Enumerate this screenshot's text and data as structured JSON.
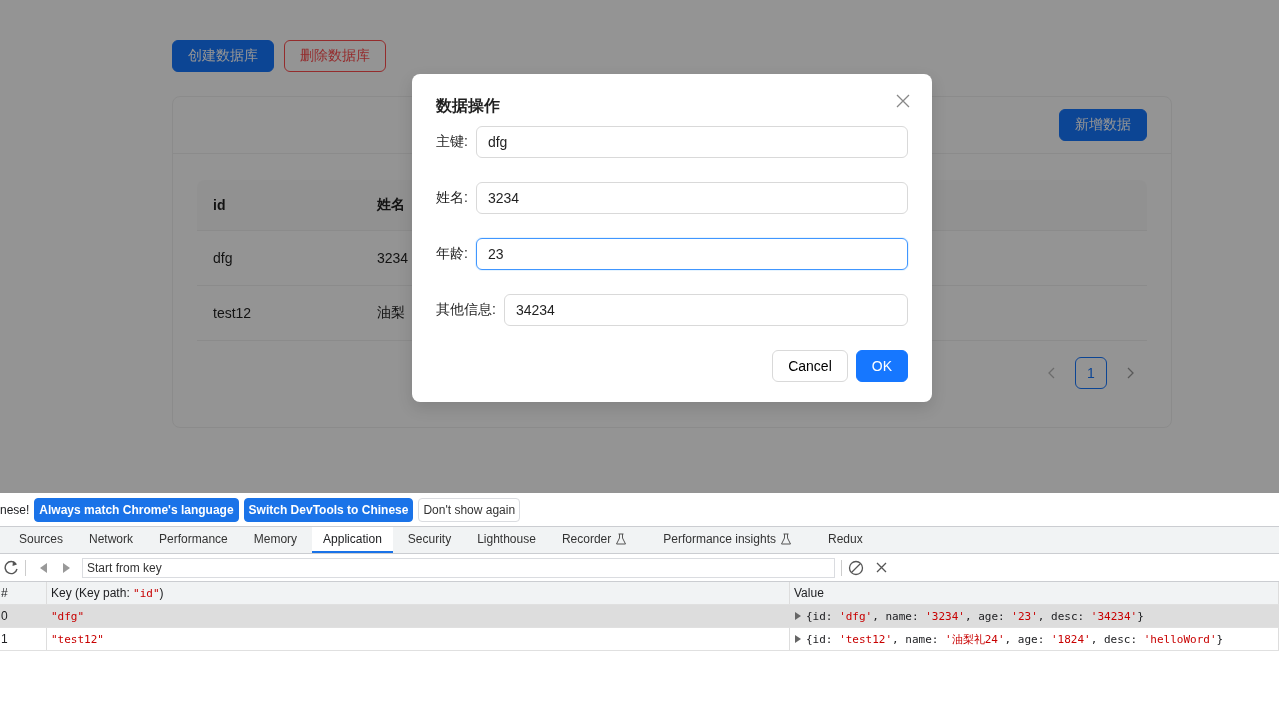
{
  "page": {
    "actions": [
      {
        "label": "创建数据库",
        "kind": "primary"
      },
      {
        "label": "删除数据库",
        "kind": "danger"
      }
    ],
    "card": {
      "add_button": "新增数据",
      "table": {
        "columns": [
          "id",
          "姓名"
        ],
        "rows": [
          [
            "dfg",
            "3234"
          ],
          [
            "test12",
            "油梨"
          ]
        ]
      },
      "pagination": [
        {
          "label": "1",
          "selected": true
        }
      ]
    }
  },
  "modal": {
    "title": "数据操作",
    "fields": [
      {
        "label": "主键:",
        "value": "dfg",
        "focused": false
      },
      {
        "label": "姓名:",
        "value": "3234",
        "focused": false
      },
      {
        "label": "年龄:",
        "value": "23",
        "focused": true
      },
      {
        "label": "其他信息:",
        "value": "34234",
        "focused": false
      }
    ],
    "buttons": [
      {
        "label": "Cancel",
        "kind": "default"
      },
      {
        "label": "OK",
        "kind": "primary"
      }
    ]
  },
  "devtools": {
    "infobar": {
      "message": "nese!",
      "buttons": [
        {
          "label": "Always match Chrome's language",
          "kind": "primary"
        },
        {
          "label": "Switch DevTools to Chinese",
          "kind": "primary"
        },
        {
          "label": "Don't show again",
          "kind": "plain"
        }
      ]
    },
    "tabs": [
      {
        "label": "Sources",
        "selected": false,
        "experimental": false
      },
      {
        "label": "Network",
        "selected": false,
        "experimental": false
      },
      {
        "label": "Performance",
        "selected": false,
        "experimental": false
      },
      {
        "label": "Memory",
        "selected": false,
        "experimental": false
      },
      {
        "label": "Application",
        "selected": true,
        "experimental": false
      },
      {
        "label": "Security",
        "selected": false,
        "experimental": false
      },
      {
        "label": "Lighthouse",
        "selected": false,
        "experimental": false
      },
      {
        "label": "Recorder",
        "selected": false,
        "experimental": true
      },
      {
        "label": "Performance insights",
        "selected": false,
        "experimental": true
      },
      {
        "label": "Redux",
        "selected": false,
        "experimental": false
      }
    ],
    "toolbar": {
      "placeholder": "Start from key"
    },
    "table": {
      "index_column": "#",
      "key_column": {
        "text": "Key (Key path: ",
        "path": "\"id\"",
        "suffix": ")"
      },
      "value_column": "Value",
      "rows": [
        {
          "index": "0",
          "key": "\"dfg\"",
          "value": "{id: 'dfg', name: '3234', age: '23', desc: '34234'}",
          "selected": true
        },
        {
          "index": "1",
          "key": "\"test12\"",
          "value": "{id: 'test12', name: '油梨礼24', age: '1824', desc: 'helloWord'}",
          "selected": false
        }
      ]
    }
  }
}
